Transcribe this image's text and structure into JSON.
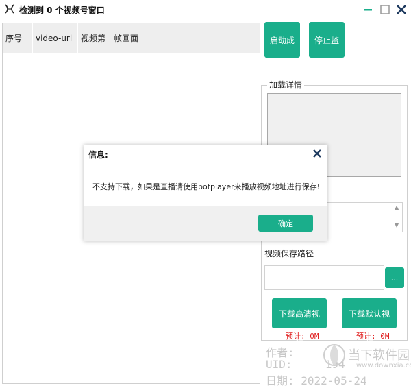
{
  "window": {
    "title": "检测到 0 个视频号窗口"
  },
  "table": {
    "columns": [
      "序号",
      "video-url",
      "视频第一帧画面"
    ]
  },
  "controls": {
    "start_label": "启动成功",
    "stop_label": "停止监控",
    "details_legend": "加载详情",
    "save_path_label": "视频保存路径",
    "save_path_value": "",
    "browse_label": "...",
    "download_hd_label": "下载高清视频",
    "download_default_label": "下载默认视频",
    "estimate_hd": "预计: 0M",
    "estimate_default": "预计: 0M"
  },
  "watermark": {
    "author": "作者:",
    "uid": "UID:",
    "uid_value": "194",
    "date": "日期: 2022-05-24",
    "site_name": "当下软件园",
    "site_url": "www.downxia.com"
  },
  "dialog": {
    "title": "信息:",
    "message": "不支持下载，如果是直播请使用potplayer来播放视频地址进行保存!",
    "ok_label": "确定"
  },
  "colors": {
    "accent": "#1aae8b",
    "estimate_text": "#e02020"
  },
  "icons": {
    "app": "app-logo-icon",
    "minimize": "minimize-icon",
    "maximize": "maximize-icon",
    "close": "close-icon",
    "dialog_close": "close-icon"
  }
}
